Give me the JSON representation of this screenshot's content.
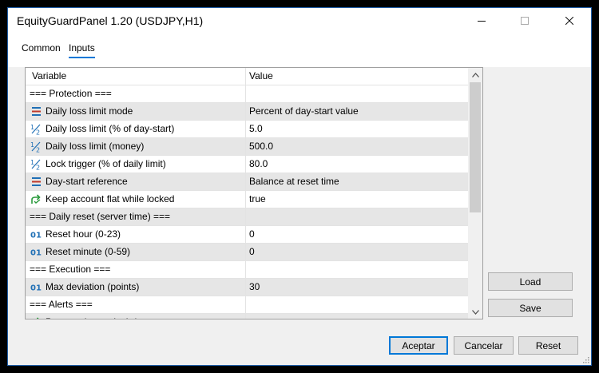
{
  "window": {
    "title": "EquityGuardPanel 1.20 (USDJPY,H1)"
  },
  "tabs": [
    {
      "label": "Common",
      "active": false
    },
    {
      "label": "Inputs",
      "active": true
    }
  ],
  "grid": {
    "columns": {
      "variable": "Variable",
      "value": "Value"
    },
    "rows": [
      {
        "type": "section",
        "variable": "=== Protection ===",
        "value": ""
      },
      {
        "type": "param",
        "icon": "list-icon",
        "variable": "Daily loss limit mode",
        "value": "Percent of day-start value"
      },
      {
        "type": "param",
        "icon": "fraction-icon",
        "variable": "Daily loss limit (% of day-start)",
        "value": "5.0"
      },
      {
        "type": "param",
        "icon": "fraction-icon",
        "variable": "Daily loss limit (money)",
        "value": "500.0"
      },
      {
        "type": "param",
        "icon": "fraction-icon",
        "variable": "Lock trigger (% of daily limit)",
        "value": "80.0"
      },
      {
        "type": "param",
        "icon": "list-icon",
        "variable": "Day-start reference",
        "value": "Balance at reset time"
      },
      {
        "type": "param",
        "icon": "bool-icon",
        "variable": "Keep account flat while locked",
        "value": "true"
      },
      {
        "type": "section",
        "variable": "=== Daily reset (server time) ===",
        "value": ""
      },
      {
        "type": "param",
        "icon": "integer-icon",
        "variable": "Reset hour (0-23)",
        "value": "0"
      },
      {
        "type": "param",
        "icon": "integer-icon",
        "variable": "Reset minute (0-59)",
        "value": "0"
      },
      {
        "type": "section",
        "variable": "=== Execution ===",
        "value": ""
      },
      {
        "type": "param",
        "icon": "integer-icon",
        "variable": "Max deviation (points)",
        "value": "30"
      },
      {
        "type": "section",
        "variable": "=== Alerts ===",
        "value": ""
      },
      {
        "type": "param",
        "icon": "bool-icon",
        "variable": "Pop-up alert on lock / reset",
        "value": "true"
      }
    ],
    "scroll_position": 0.0
  },
  "side_buttons": {
    "load": "Load",
    "save": "Save"
  },
  "footer_buttons": {
    "ok": "Aceptar",
    "cancel": "Cancelar",
    "reset": "Reset"
  },
  "colors": {
    "accent": "#0078d7",
    "icon_blue": "#1f6fb5",
    "icon_green": "#2a9a3c",
    "icon_red": "#c0392b"
  }
}
